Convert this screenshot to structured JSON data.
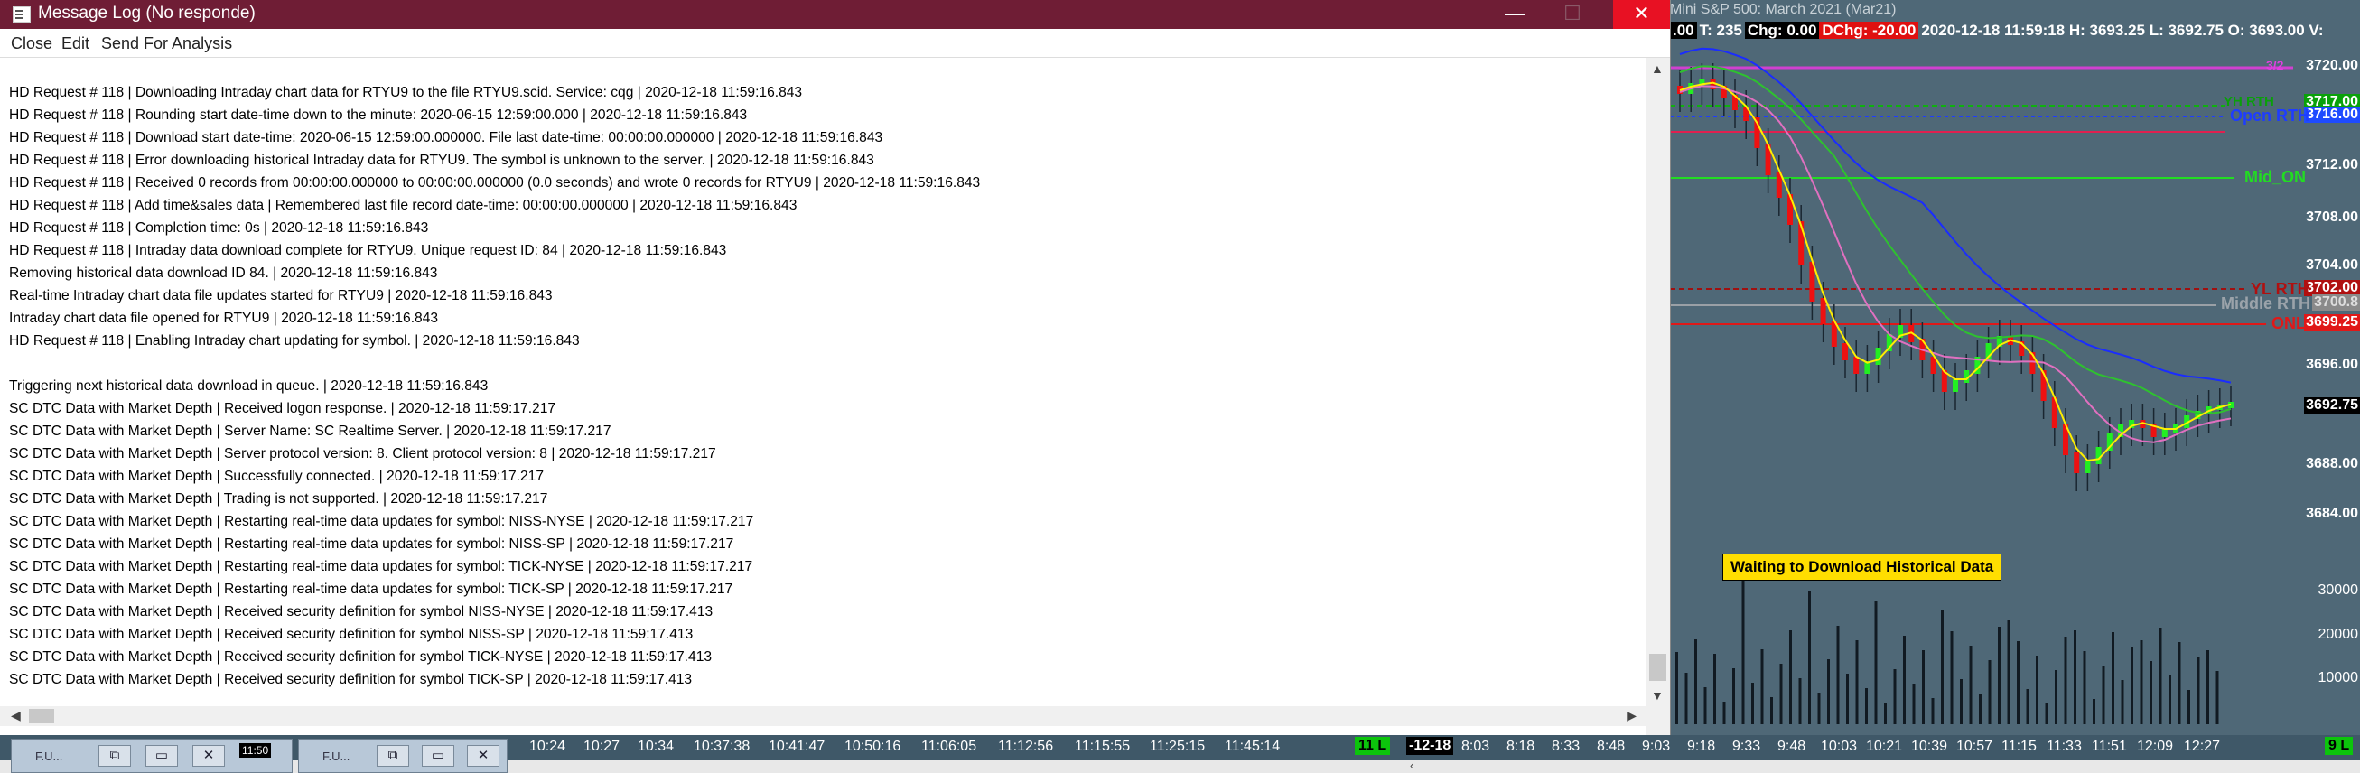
{
  "window": {
    "title": "Message Log (No responde)",
    "caption_min": "—",
    "caption_max": "☐",
    "caption_close": "✕",
    "menu": [
      "Close",
      "Edit",
      "Send For Analysis"
    ]
  },
  "log_lines": [
    "HD Request # 118 | Downloading Intraday chart data for RTYU9 to the file RTYU9.scid.  Service: cqg | 2020-12-18  11:59:16.843",
    "HD Request # 118 | Rounding start date-time down to the minute: 2020-06-15  12:59:00.000 | 2020-12-18  11:59:16.843",
    "HD Request # 118 | Download start date-time: 2020-06-15  12:59:00.000000. File last date-time: 00:00:00.000000 | 2020-12-18  11:59:16.843",
    "HD Request # 118 | Error downloading historical Intraday data for RTYU9.  The symbol is unknown to the server. | 2020-12-18  11:59:16.843",
    "HD Request # 118 | Received 0 records from 00:00:00.000000 to 00:00:00.000000 (0.0 seconds) and wrote 0 records for RTYU9 | 2020-12-18  11:59:16.843",
    "HD Request # 118 | Add time&sales data | Remembered last file record date-time: 00:00:00.000000 | 2020-12-18  11:59:16.843",
    "HD Request # 118 | Completion time: 0s | 2020-12-18  11:59:16.843",
    "HD Request # 118 |  Intraday data  download complete for RTYU9. Unique request ID: 84 | 2020-12-18  11:59:16.843",
    "Removing historical data download ID 84. | 2020-12-18  11:59:16.843",
    "Real-time Intraday chart data file updates started for RTYU9 | 2020-12-18  11:59:16.843",
    "Intraday chart data file opened for RTYU9 | 2020-12-18  11:59:16.843",
    "HD Request # 118 | Enabling Intraday chart updating for symbol. | 2020-12-18  11:59:16.843",
    "",
    "Triggering next historical data download in queue. | 2020-12-18  11:59:16.843",
    "SC DTC Data with Market Depth | Received logon response. | 2020-12-18  11:59:17.217",
    "SC DTC Data with Market Depth | Server Name: SC Realtime Server. | 2020-12-18  11:59:17.217",
    "SC DTC Data with Market Depth | Server protocol version: 8. Client protocol version: 8 | 2020-12-18  11:59:17.217",
    "SC DTC Data with Market Depth | Successfully connected. | 2020-12-18  11:59:17.217",
    "SC DTC Data with Market Depth | Trading is not supported. | 2020-12-18  11:59:17.217",
    "SC DTC Data with Market Depth | Restarting real-time data updates for symbol: NISS-NYSE | 2020-12-18  11:59:17.217",
    "SC DTC Data with Market Depth | Restarting real-time data updates for symbol: NISS-SP | 2020-12-18  11:59:17.217",
    "SC DTC Data with Market Depth | Restarting real-time data updates for symbol: TICK-NYSE | 2020-12-18  11:59:17.217",
    "SC DTC Data with Market Depth | Restarting real-time data updates for symbol: TICK-SP | 2020-12-18  11:59:17.217",
    "SC DTC Data with Market Depth | Received security definition for symbol NISS-NYSE | 2020-12-18  11:59:17.413",
    "SC DTC Data with Market Depth | Received security definition for symbol NISS-SP | 2020-12-18  11:59:17.413",
    "SC DTC Data with Market Depth | Received security definition for symbol TICK-NYSE | 2020-12-18  11:59:17.413",
    "SC DTC Data with Market Depth | Received security definition for symbol TICK-SP | 2020-12-18  11:59:17.413"
  ],
  "chart": {
    "title": "Mini S&P 500: March 2021 (Mar21)",
    "info": {
      "a": ".00",
      "b": "T: 235",
      "chg": "Chg: 0.00",
      "dchg": "DChg: -20.00",
      "rest": "2020-12-18 11:59:18 H: 3693.25 L: 3692.75 O: 3693.00 V:"
    },
    "price_axis": [
      "3720.00",
      "3712.00",
      "3708.00",
      "3704.00",
      "3696.00",
      "3688.00",
      "3684.00"
    ],
    "price_tags": {
      "yh_top": "3717.00",
      "open_rth": "3716.00",
      "yl_rth": "3702.00",
      "middle_rth": "3700.8",
      "onl": "3699.25",
      "last": "3692.75"
    },
    "line_labels": {
      "yh": "YH RTH",
      "open_rth": "Open RTH",
      "mid_on": "Mid_ON",
      "yl_rth": "YL RTH",
      "middle_rth": "Middle RTH",
      "onl": "ONL",
      "corner": "3/2"
    },
    "volume_axis": [
      "30000",
      "20000",
      "10000"
    ],
    "banner": "Waiting to Download Historical Data",
    "time_labels_left": [
      "10:24",
      "10:27",
      "10:34",
      "10:37:38",
      "10:41:47",
      "10:50:16",
      "11:06:05",
      "11:12:56",
      "11:15:55",
      "11:25:15",
      "11:45:14"
    ],
    "left_badge": "11 L",
    "date_badge": "-12-18",
    "time_labels_right": [
      "8:03",
      "8:18",
      "8:33",
      "8:48",
      "9:03",
      "9:18",
      "9:33",
      "9:48",
      "10:03",
      "10:21",
      "10:39",
      "10:57",
      "11:15",
      "11:33",
      "11:51",
      "12:09",
      "12:27"
    ],
    "right_badge": "9 L",
    "clock_tag": "11:50"
  },
  "taskbar_tabs": [
    {
      "label": "F.U..."
    },
    {
      "label": "F.U..."
    }
  ],
  "colors": {
    "title_bar": "#6f1d35",
    "close_btn": "#e81123",
    "chart_bg": "#4f6877",
    "banner": "#ffde00"
  }
}
